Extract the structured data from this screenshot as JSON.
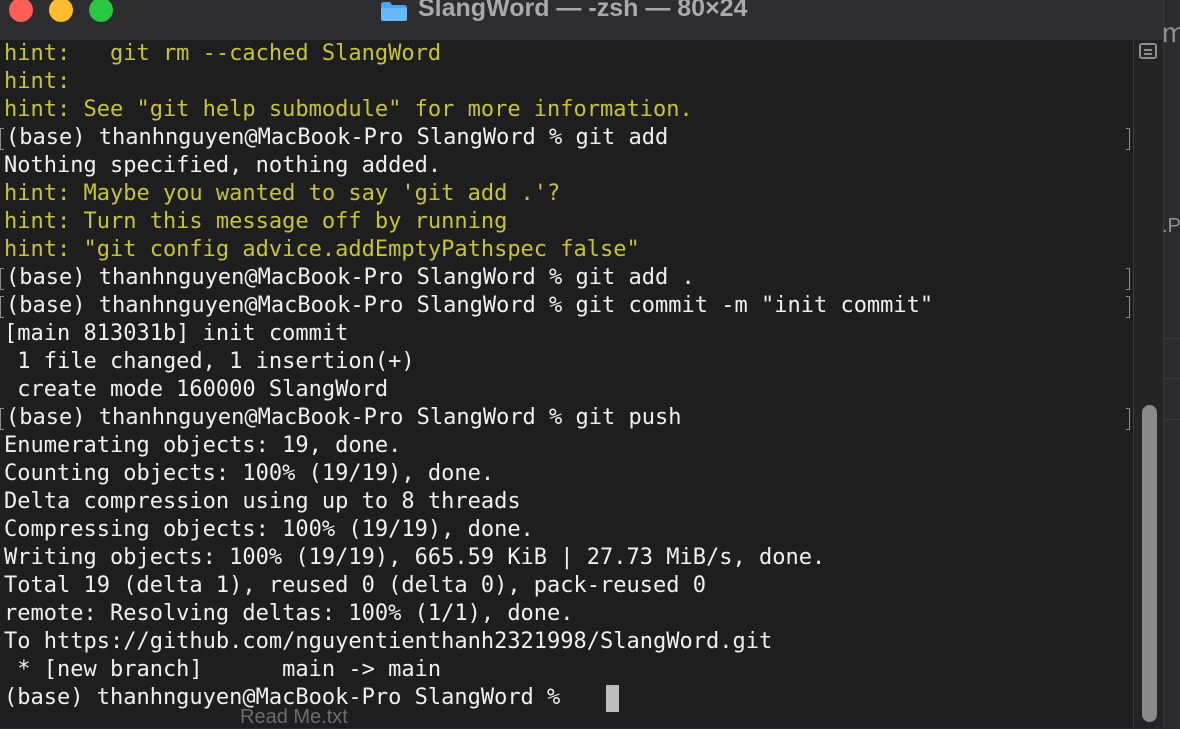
{
  "window": {
    "title": "SlangWord — -zsh — 80×24"
  },
  "background": {
    "right_fragment_top": "m",
    "right_fragment_mid": ".P",
    "bottom_fragment": "Read Me.txt"
  },
  "terminal": {
    "lines": [
      {
        "text": "hint:   git rm --cached SlangWord",
        "kind": "hint"
      },
      {
        "text": "hint:",
        "kind": "hint"
      },
      {
        "text": "hint: See \"git help submodule\" for more information.",
        "kind": "hint"
      },
      {
        "text": "(base) thanhnguyen@MacBook-Pro SlangWord % git add",
        "kind": "prompt"
      },
      {
        "text": "Nothing specified, nothing added.",
        "kind": "normal"
      },
      {
        "text": "hint: Maybe you wanted to say 'git add .'?",
        "kind": "hint"
      },
      {
        "text": "hint: Turn this message off by running",
        "kind": "hint"
      },
      {
        "text": "hint: \"git config advice.addEmptyPathspec false\"",
        "kind": "hint"
      },
      {
        "text": "(base) thanhnguyen@MacBook-Pro SlangWord % git add .",
        "kind": "prompt"
      },
      {
        "text": "(base) thanhnguyen@MacBook-Pro SlangWord % git commit -m \"init commit\"",
        "kind": "prompt"
      },
      {
        "text": "[main 813031b] init commit",
        "kind": "normal"
      },
      {
        "text": " 1 file changed, 1 insertion(+)",
        "kind": "normal"
      },
      {
        "text": " create mode 160000 SlangWord",
        "kind": "normal"
      },
      {
        "text": "(base) thanhnguyen@MacBook-Pro SlangWord % git push",
        "kind": "prompt"
      },
      {
        "text": "Enumerating objects: 19, done.",
        "kind": "normal"
      },
      {
        "text": "Counting objects: 100% (19/19), done.",
        "kind": "normal"
      },
      {
        "text": "Delta compression using up to 8 threads",
        "kind": "normal"
      },
      {
        "text": "Compressing objects: 100% (19/19), done.",
        "kind": "normal"
      },
      {
        "text": "Writing objects: 100% (19/19), 665.59 KiB | 27.73 MiB/s, done.",
        "kind": "normal"
      },
      {
        "text": "Total 19 (delta 1), reused 0 (delta 0), pack-reused 0",
        "kind": "normal"
      },
      {
        "text": "remote: Resolving deltas: 100% (1/1), done.",
        "kind": "normal"
      },
      {
        "text": "To https://github.com/nguyentienthanh2321998/SlangWord.git",
        "kind": "normal"
      },
      {
        "text": " * [new branch]      main -> main",
        "kind": "normal"
      },
      {
        "text": "(base) thanhnguyen@MacBook-Pro SlangWord % ",
        "kind": "current-prompt"
      }
    ]
  },
  "colors": {
    "window_background": "#1e1e1e",
    "text": "#f0f0f0",
    "hint_text": "#c7c33a",
    "cursor": "#bcbcbc",
    "close": "#fe5f57",
    "minimize": "#febc2e",
    "zoom": "#28c840"
  },
  "icons": {
    "title_icon": "folder-icon",
    "scroll_control": "marked-lines-icon"
  }
}
